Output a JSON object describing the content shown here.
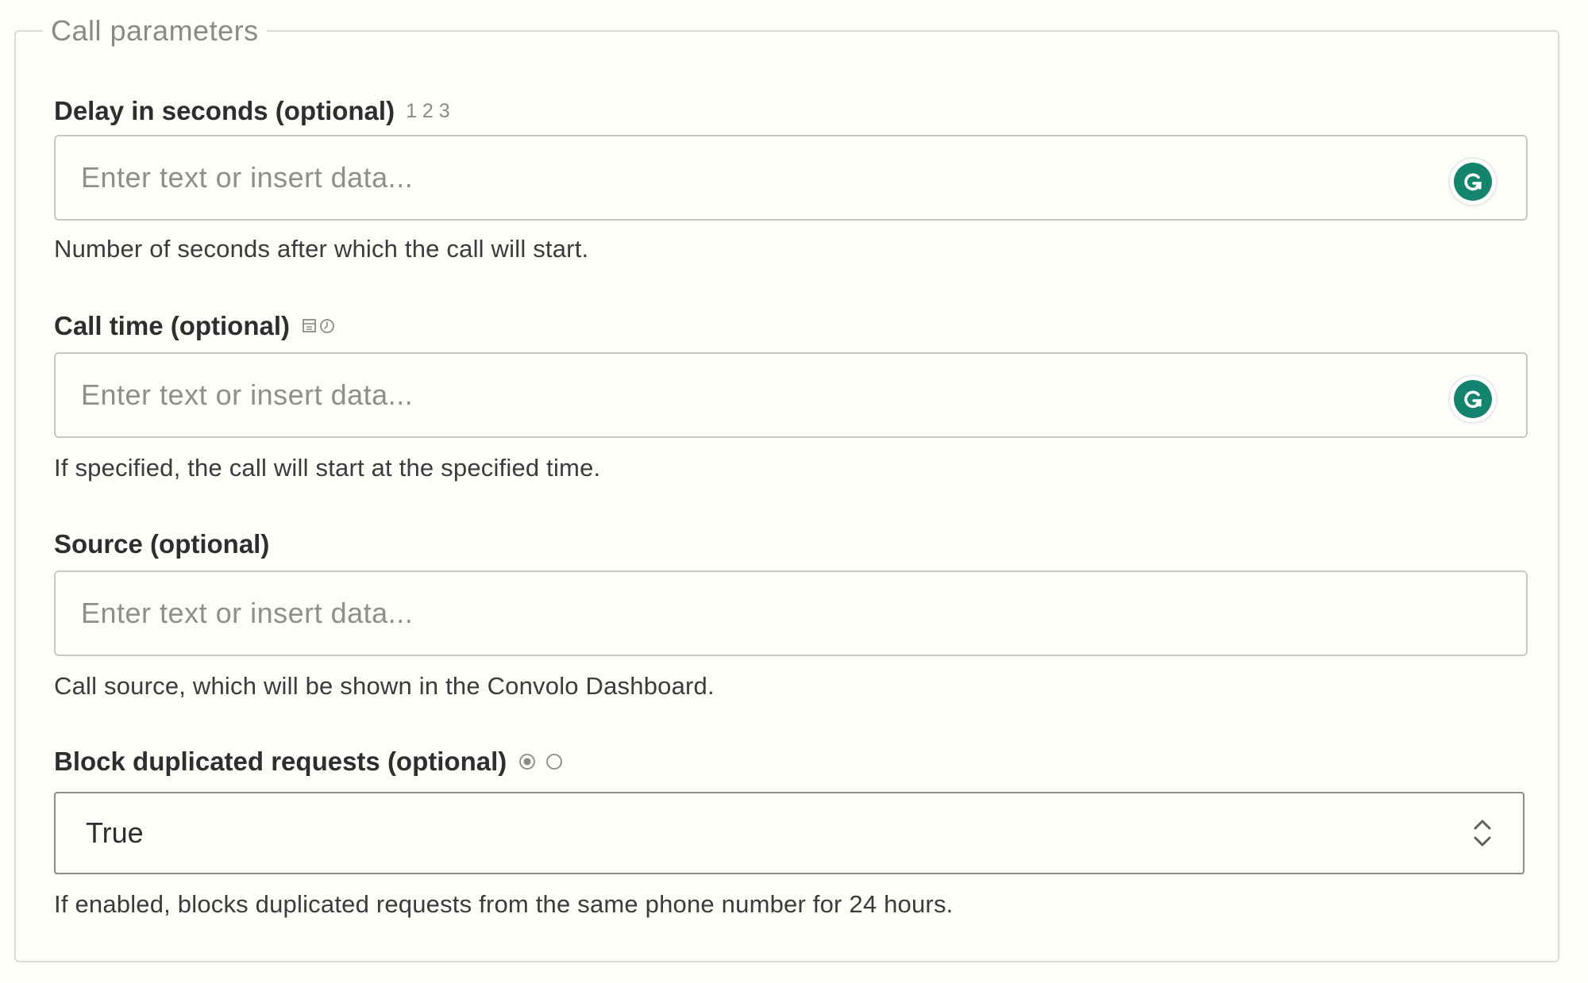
{
  "fieldset": {
    "legend": "Call parameters"
  },
  "fields": [
    {
      "label": "Delay in seconds (optional)",
      "hint": "1 2 3",
      "placeholder": "Enter text or insert data...",
      "help": "Number of seconds after which the call will start.",
      "icon": "grammarly-icon"
    },
    {
      "label": "Call time (optional)",
      "hint_icon": "calendar-clock-icon",
      "placeholder": "Enter text or insert data...",
      "help": "If specified, the call will start at the specified time.",
      "icon": "grammarly-icon"
    },
    {
      "label": "Source (optional)",
      "placeholder": "Enter text or insert data...",
      "help": "Call source, which will be shown in the Convolo Dashboard."
    },
    {
      "label": "Block duplicated requests (optional)",
      "hint_icon": "radio-boolean-icon",
      "value": "True",
      "help": "If enabled, blocks duplicated requests from the same phone number for 24 hours."
    }
  ],
  "colors": {
    "background": "#fffdf9",
    "grammarly_green": "#15846e",
    "border": "#c9c7c3"
  }
}
